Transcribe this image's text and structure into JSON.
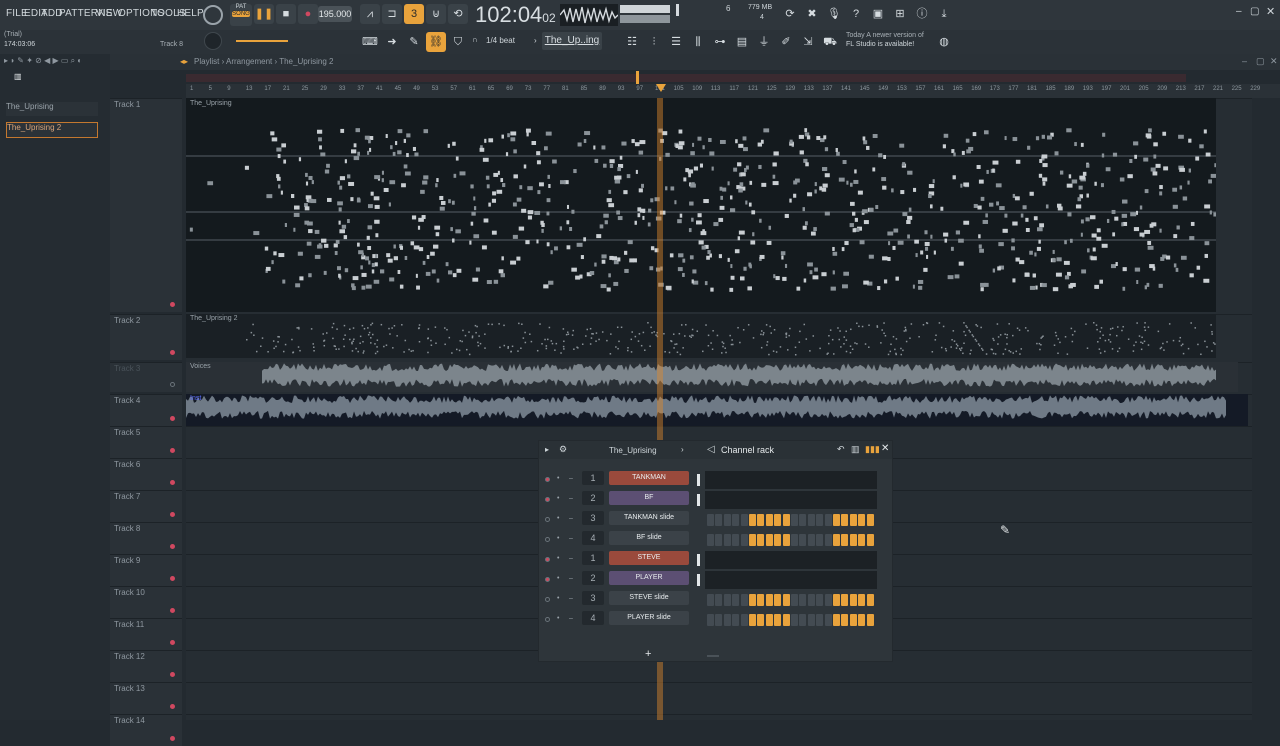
{
  "menu": [
    "FILE",
    "EDIT",
    "ADD",
    "PATTERNS",
    "VIEW",
    "OPTIONS",
    "TOOLS",
    "HELP"
  ],
  "transport": {
    "pat_label": "PAT",
    "song_label": "SONG",
    "tempo": "195.000",
    "time_main": "102:04",
    "time_sub": "02",
    "cpu_mem": "779 MB",
    "cpu_num": "4",
    "mem_top": "6"
  },
  "status": {
    "trial": "(Trial)",
    "time": "174:03:06",
    "track_hint": "Track 8"
  },
  "snap": "1/4 beat",
  "pattern_selector": "The_Up..ing 2",
  "news": {
    "line1": "Today  A newer version of",
    "line2": "FL Studio is available!"
  },
  "playlist": {
    "breadcrumb": "Playlist › Arrangement › The_Uprising 2",
    "picker": [
      "The_Uprising",
      "The_Uprising 2"
    ]
  },
  "timeline_ticks": [
    "1",
    "5",
    "9",
    "13",
    "17",
    "21",
    "25",
    "29",
    "33",
    "37",
    "41",
    "45",
    "49",
    "53",
    "57",
    "61",
    "65",
    "69",
    "73",
    "77",
    "81",
    "85",
    "89",
    "93",
    "97",
    "101",
    "105",
    "109",
    "113",
    "117",
    "121",
    "125",
    "129",
    "133",
    "137",
    "141",
    "145",
    "149",
    "153",
    "157",
    "161",
    "165",
    "169",
    "173",
    "177",
    "181",
    "185",
    "189",
    "193",
    "197",
    "201",
    "205",
    "209",
    "213",
    "217",
    "221",
    "225",
    "229"
  ],
  "tracks": [
    "Track 1",
    "Track 2",
    "Track 3",
    "Track 4",
    "Track 5",
    "Track 6",
    "Track 7",
    "Track 8",
    "Track 9",
    "Track 10",
    "Track 11",
    "Track 12",
    "Track 13",
    "Track 14"
  ],
  "clips": {
    "t1": "The_Uprising",
    "t2": "The_Uprising 2",
    "t3": "Voices",
    "t4": "Inst"
  },
  "rack": {
    "pattern": "The_Uprising",
    "title": "Channel rack",
    "add": "+",
    "channels": [
      {
        "num": "1",
        "name": "TANKMAN",
        "color": "#9a4a3c",
        "steps": null
      },
      {
        "num": "2",
        "name": "BF",
        "color": "#5c4f73",
        "steps": null
      },
      {
        "num": "3",
        "name": "TANKMAN slide",
        "color": "#3b4248",
        "steps": [
          0,
          0,
          0,
          0,
          0,
          1,
          1,
          1,
          1,
          1,
          0,
          0,
          0,
          0,
          0,
          1,
          1,
          1,
          1,
          1
        ]
      },
      {
        "num": "4",
        "name": "BF slide",
        "color": "#3b4248",
        "steps": [
          0,
          0,
          0,
          0,
          0,
          1,
          1,
          1,
          1,
          1,
          0,
          0,
          0,
          0,
          0,
          1,
          1,
          1,
          1,
          1
        ]
      },
      {
        "num": "1",
        "name": "STEVE",
        "color": "#9a4a3c",
        "steps": null
      },
      {
        "num": "2",
        "name": "PLAYER",
        "color": "#5c4f73",
        "steps": null
      },
      {
        "num": "3",
        "name": "STEVE slide",
        "color": "#3b4248",
        "steps": [
          0,
          0,
          0,
          0,
          0,
          1,
          1,
          1,
          1,
          1,
          0,
          0,
          0,
          0,
          0,
          1,
          1,
          1,
          1,
          1
        ]
      },
      {
        "num": "4",
        "name": "PLAYER slide",
        "color": "#3b4248",
        "steps": [
          0,
          0,
          0,
          0,
          0,
          1,
          1,
          1,
          1,
          1,
          0,
          0,
          0,
          0,
          0,
          1,
          1,
          1,
          1,
          1
        ]
      }
    ]
  },
  "colors": {
    "accent": "#e9a33c",
    "playhead": "#e08a2c",
    "mute": "#d04860"
  }
}
